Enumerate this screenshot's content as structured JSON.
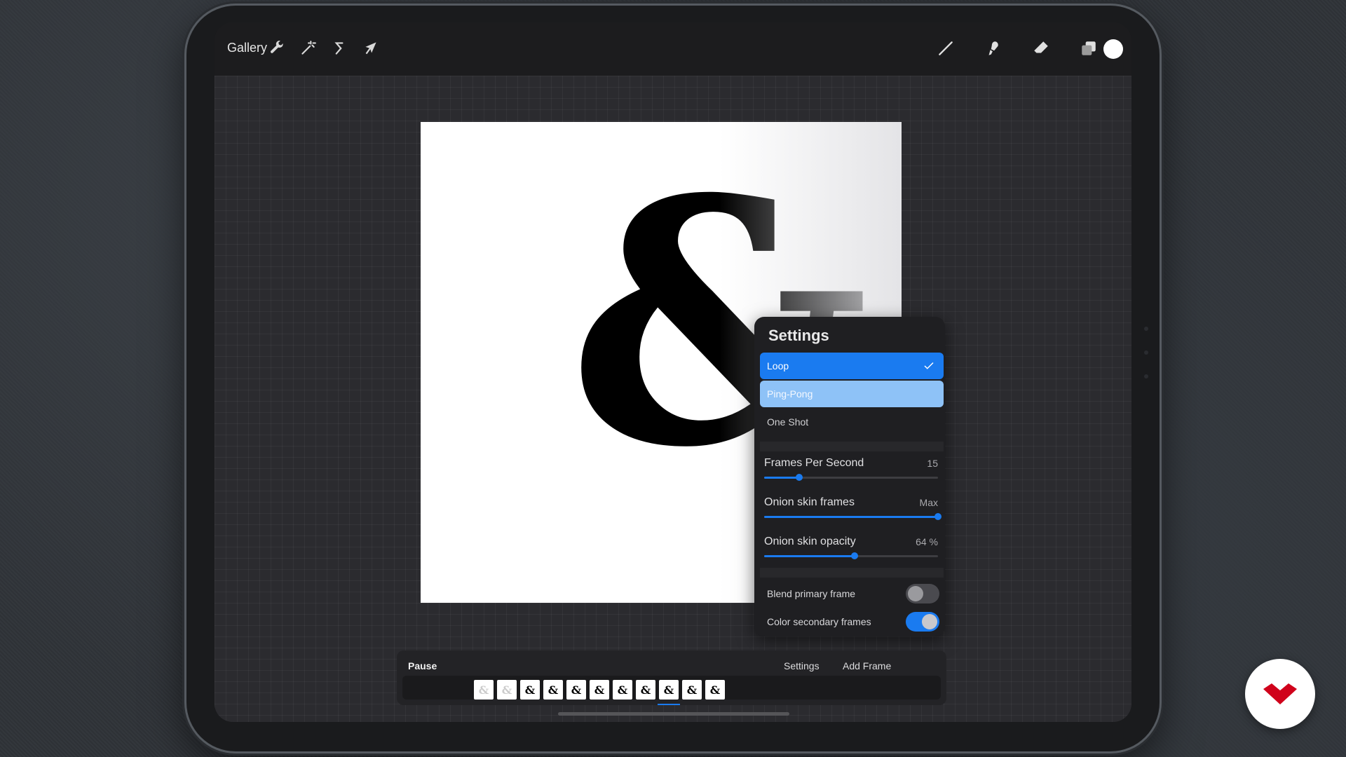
{
  "topbar": {
    "gallery_label": "Gallery",
    "left_icons": [
      "wrench-icon",
      "magic-wand-icon",
      "selection-icon",
      "transform-arrow-icon"
    ],
    "right_icons": [
      "brush-icon",
      "smudge-icon",
      "eraser-icon",
      "layers-icon"
    ],
    "current_color": "#ffffff"
  },
  "canvas": {
    "glyph": "&"
  },
  "settings": {
    "title": "Settings",
    "playback_options": [
      {
        "label": "Loop",
        "selected": true
      },
      {
        "label": "Ping-Pong",
        "selected": false
      },
      {
        "label": "One Shot",
        "selected": false
      }
    ],
    "sliders": [
      {
        "label": "Frames Per Second",
        "value_text": "15",
        "fraction": 0.2
      },
      {
        "label": "Onion skin frames",
        "value_text": "Max",
        "fraction": 1.0
      },
      {
        "label": "Onion skin opacity",
        "value_text": "64 %",
        "fraction": 0.52
      }
    ],
    "toggles": [
      {
        "label": "Blend primary frame",
        "on": false
      },
      {
        "label": "Color secondary frames",
        "on": true
      }
    ]
  },
  "timeline": {
    "pause_label": "Pause",
    "settings_label": "Settings",
    "add_frame_label": "Add Frame",
    "frame_count": 11,
    "current_frame": 9,
    "frame_glyph": "&"
  },
  "colors": {
    "accent": "#1a7bf0",
    "accent_light": "#8ec2f7",
    "logo_red": "#d0021b"
  }
}
